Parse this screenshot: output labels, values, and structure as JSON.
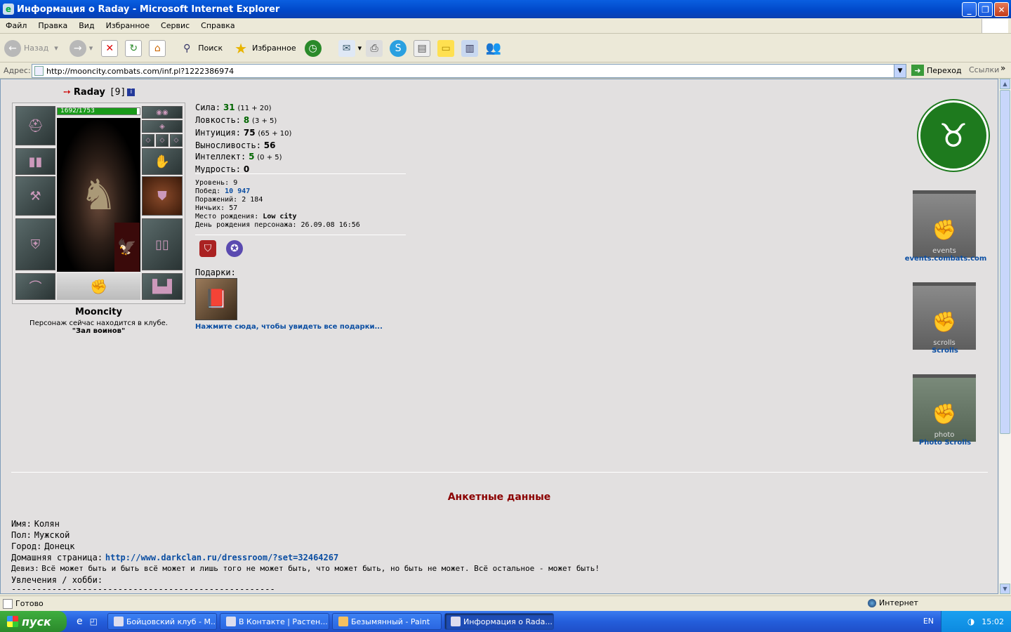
{
  "window": {
    "title": "Информация о Raday - Microsoft Internet Explorer"
  },
  "menu": [
    "Файл",
    "Правка",
    "Вид",
    "Избранное",
    "Сервис",
    "Справка"
  ],
  "toolbar": {
    "back": "Назад",
    "search": "Поиск",
    "favorites": "Избранное"
  },
  "address": {
    "label": "Адрес:",
    "url": "http://mooncity.combats.com/inf.pl?1222386974",
    "go": "Переход",
    "links": "Ссылки"
  },
  "character": {
    "name": "Raday",
    "level": "[9]",
    "hp": "1692/1753",
    "hp_fraction": 0.965,
    "club": "Mooncity",
    "location_line": "Персонаж сейчас находится в клубе.",
    "location_place": "\"Зал воинов\""
  },
  "stats": {
    "strength": {
      "label": "Сила:",
      "value": "31",
      "extra": "(11 + 20)"
    },
    "agility": {
      "label": "Ловкость:",
      "value": "8",
      "extra": "(3 + 5)"
    },
    "intuition": {
      "label": "Интуиция:",
      "value": "75",
      "extra": "(65 + 10)"
    },
    "endurance": {
      "label": "Выносливость:",
      "value": "56"
    },
    "intellect": {
      "label": "Интеллект:",
      "value": "5",
      "extra": "(0 + 5)"
    },
    "wisdom": {
      "label": "Мудрость:",
      "value": "0"
    }
  },
  "records": {
    "level": {
      "label": "Уровень:",
      "value": "9"
    },
    "wins": {
      "label": "Побед:",
      "value": "10 947"
    },
    "losses": {
      "label": "Поражений:",
      "value": "2 184"
    },
    "draws": {
      "label": "Ничьих:",
      "value": "57"
    },
    "birthplace": {
      "label": "Место рождения:",
      "value": "Low city"
    },
    "birthday": {
      "label": "День рождения персонажа:",
      "value": "26.09.08 16:56"
    }
  },
  "gifts": {
    "label": "Подарки:",
    "link": "Нажмите сюда, чтобы увидеть все подарки..."
  },
  "side_links": {
    "events": "events.combats.com",
    "scrolls": "Scrolls",
    "photo": "Photo Scrolls",
    "events_emblem": "events",
    "scrolls_emblem": "scrolls",
    "photo_emblem": "photo"
  },
  "anketa": {
    "title": "Анкетные данные",
    "name": {
      "label": "Имя:",
      "value": "Колян"
    },
    "gender": {
      "label": "Пол:",
      "value": "Мужской"
    },
    "city": {
      "label": "Город:",
      "value": "Донецк"
    },
    "homepage": {
      "label": "Домашняя страница:",
      "value": "http://www.darkclan.ru/dressroom/?set=32464267"
    },
    "motto": {
      "label": "Девиз:",
      "value": "Всё может быть и быть всё может и лишь того не может быть, что может быть, но быть не может. Всё остальное - может быть!"
    },
    "hobby": {
      "label": "Увлечения / хобби:",
      "value": "----------------------------------------------------"
    }
  },
  "status": {
    "text": "Готово",
    "zone": "Интернет"
  },
  "taskbar": {
    "start": "пуск",
    "tasks": [
      "Бойцовский клуб - M...",
      "В Контакте | Растен...",
      "Безымянный - Paint",
      "Информация о Rada..."
    ],
    "lang": "EN",
    "clock": "15:02"
  }
}
